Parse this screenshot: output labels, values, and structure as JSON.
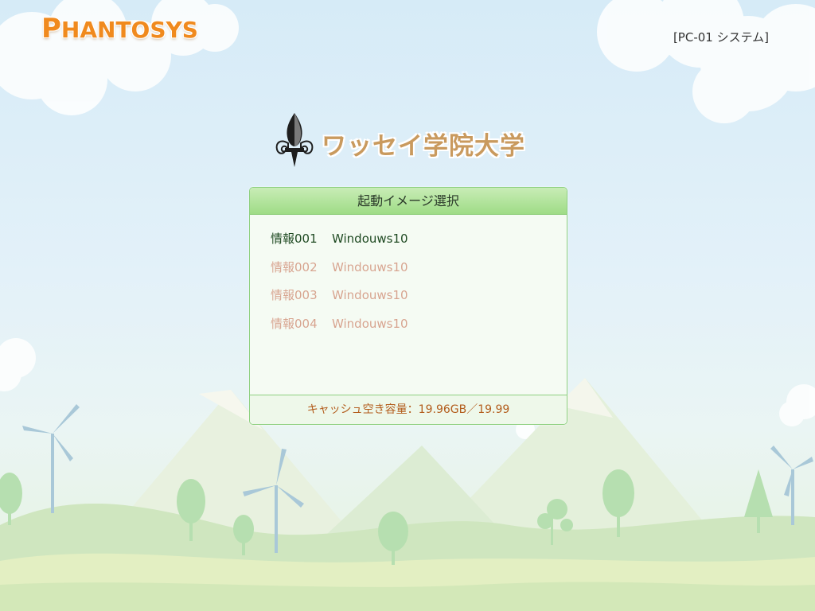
{
  "header": {
    "logo_first": "P",
    "logo_rest": "HANTOSYS",
    "system_name": "[PC-01 システム]"
  },
  "brand": {
    "emblem": "fleur-de-lis-icon",
    "title": "ワッセイ学院大学"
  },
  "panel": {
    "title": "起動イメージ選択",
    "items": [
      {
        "name": "情報001",
        "os": "Windouws10",
        "state": "active"
      },
      {
        "name": "情報002",
        "os": "Windouws10",
        "state": "dim"
      },
      {
        "name": "情報003",
        "os": "Windouws10",
        "state": "dim"
      },
      {
        "name": "情報004",
        "os": "Windouws10",
        "state": "dim"
      }
    ],
    "cache": "キャッシュ空き容量：19.96GB／19.99"
  },
  "colors": {
    "logo": "#f08a1e",
    "brand_title": "#c99a5e",
    "panel_border": "#8ed080",
    "active_item": "#1f4a22",
    "dim_item": "#d6a48e",
    "cache_text": "#b35d1d"
  }
}
